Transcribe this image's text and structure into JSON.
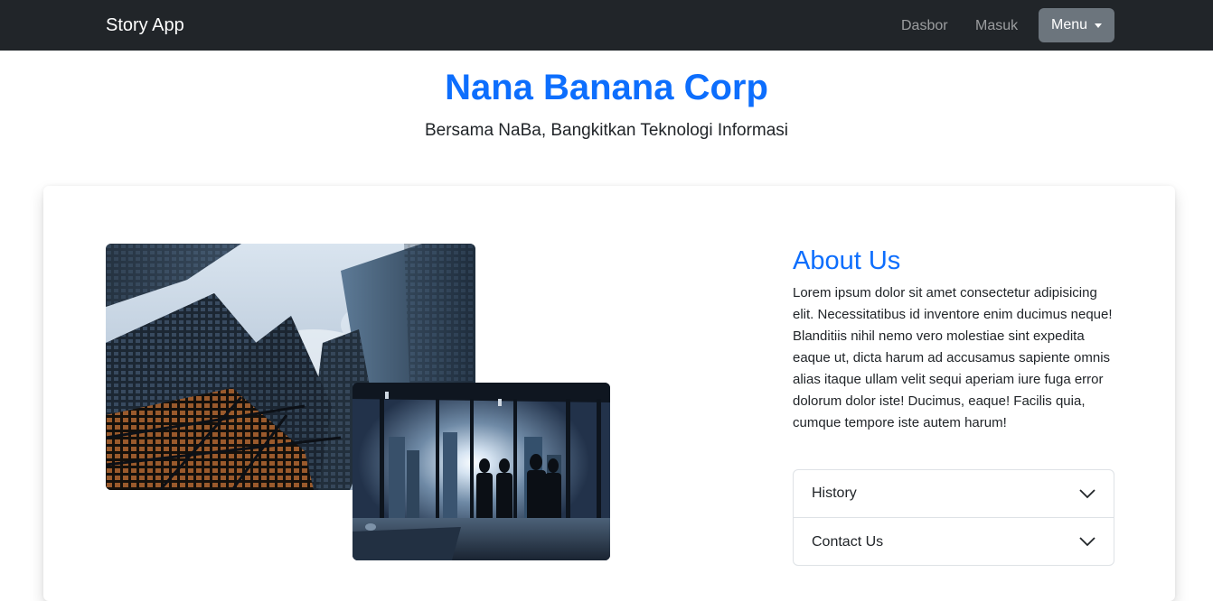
{
  "navbar": {
    "brand": "Story App",
    "links": [
      "Dasbor",
      "Masuk"
    ],
    "menu_label": "Menu"
  },
  "hero": {
    "title": "Nana Banana Corp",
    "subtitle": "Bersama NaBa, Bangkitkan Teknologi Informasi"
  },
  "about": {
    "title": "About Us",
    "text": "Lorem ipsum dolor sit amet consectetur adipisicing elit. Necessitatibus id inventore enim ducimus neque! Blanditiis nihil nemo vero molestiae sint expedita eaque ut, dicta harum ad accusamus sapiente omnis alias itaque ullam velit sequi aperiam iure fuga error dolorum dolor iste! Ducimus, eaque! Facilis quia, cumque tempore iste autem harum!",
    "accordion": [
      {
        "label": "History",
        "icon": "chevron-down-icon"
      },
      {
        "label": "Contact Us",
        "icon": "chevron-down-icon"
      }
    ]
  },
  "colors": {
    "navbar_bg": "#212529",
    "accent": "#0d6efd",
    "menu_button": "#6c757d"
  }
}
